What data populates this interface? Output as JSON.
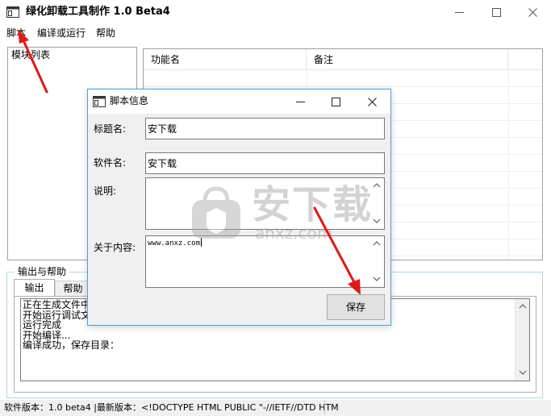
{
  "window": {
    "title": "绿化卸载工具制作 1.0 Beta4"
  },
  "menu": {
    "script": "脚本",
    "compile_run": "编译或运行",
    "help": "帮助"
  },
  "module_list": {
    "label": "模块列表"
  },
  "function_table": {
    "columns": [
      "功能名",
      "备注",
      ""
    ]
  },
  "output_group": {
    "label": "输出与帮助",
    "tabs": [
      "输出",
      "帮助"
    ],
    "log_lines": [
      "正在生成文件中...",
      "开始运行调试文件...",
      "运行完成",
      "开始编译...",
      "编译成功，保存目录："
    ]
  },
  "statusbar": {
    "text": "软件版本：1.0 beta4 |最新版本：<!DOCTYPE HTML PUBLIC \"-//IETF//DTD HTM"
  },
  "dialog": {
    "title": "脚本信息",
    "fields": {
      "title_label": "标题名:",
      "title_value": "安下载",
      "software_label": "软件名:",
      "software_value": "安下载",
      "description_label": "说明:",
      "description_value": "",
      "about_label": "关于内容:",
      "about_value": "www.anxz.com"
    },
    "save_button": "保存"
  },
  "watermark": {
    "text": "安下载",
    "url": "anxz.com"
  },
  "colors": {
    "dialog_border": "#48a4d6",
    "group_border": "#b6d4e5",
    "annotation_arrow": "#e0191b"
  }
}
